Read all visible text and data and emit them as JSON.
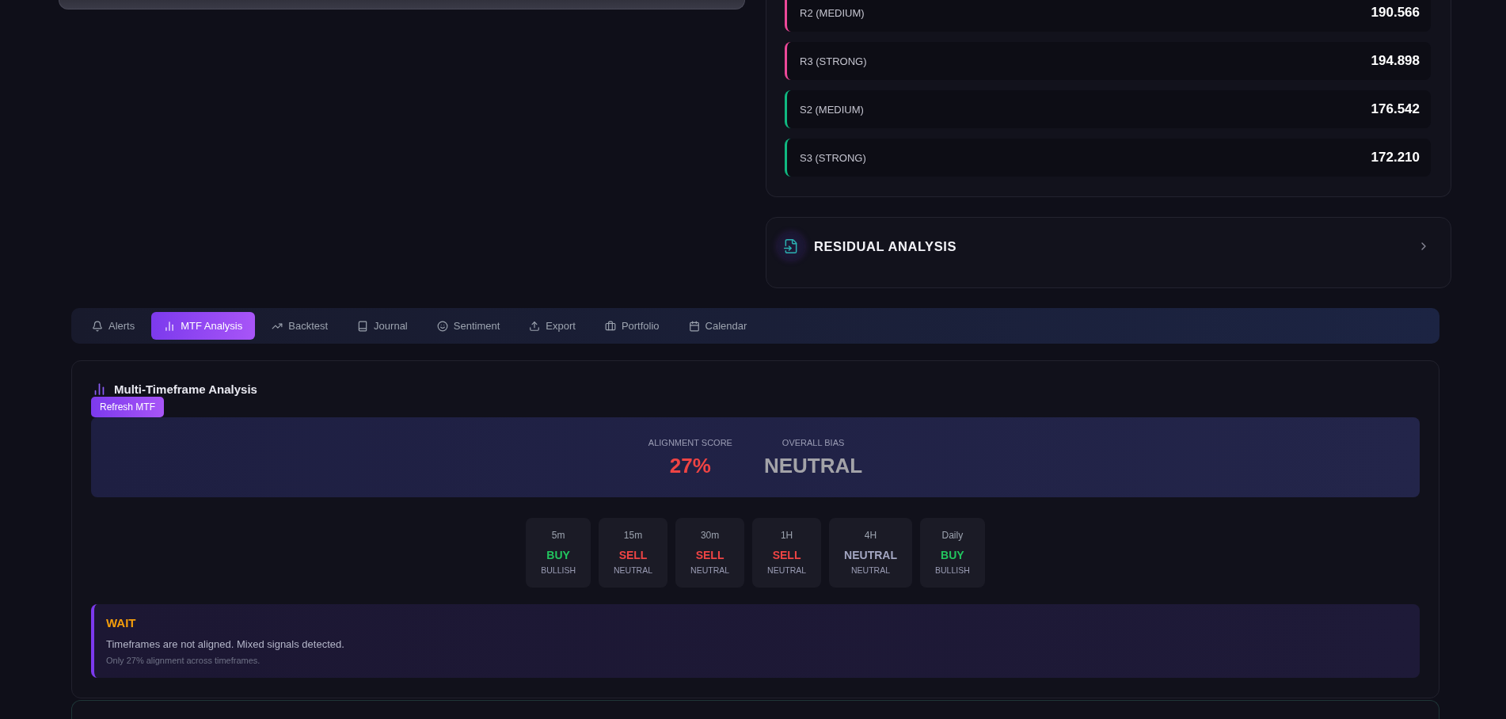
{
  "pivot_levels": [
    {
      "label": "R2 (MEDIUM)",
      "value": "190.566",
      "kind": "resistance"
    },
    {
      "label": "R3 (STRONG)",
      "value": "194.898",
      "kind": "resistance"
    },
    {
      "label": "S2 (MEDIUM)",
      "value": "176.542",
      "kind": "support"
    },
    {
      "label": "S3 (STRONG)",
      "value": "172.210",
      "kind": "support"
    }
  ],
  "residual_analysis": {
    "title": "RESIDUAL ANALYSIS",
    "expanded": false
  },
  "tabs": [
    {
      "label": "Alerts",
      "selected": false
    },
    {
      "label": "MTF Analysis",
      "selected": true
    },
    {
      "label": "Backtest",
      "selected": false
    },
    {
      "label": "Journal",
      "selected": false
    },
    {
      "label": "Sentiment",
      "selected": false
    },
    {
      "label": "Export",
      "selected": false
    },
    {
      "label": "Portfolio",
      "selected": false
    },
    {
      "label": "Calendar",
      "selected": false
    }
  ],
  "mtf_analysis": {
    "title": "Multi-Timeframe Analysis",
    "refresh_button": "Refresh MTF",
    "alignment_score": {
      "label": "ALIGNMENT SCORE",
      "value": "27%"
    },
    "overall_bias": {
      "label": "OVERALL BIAS",
      "value": "NEUTRAL"
    },
    "timeframes": [
      {
        "timeframe": "5m",
        "signal": "BUY",
        "trend": "BULLISH",
        "kind": "buy"
      },
      {
        "timeframe": "15m",
        "signal": "SELL",
        "trend": "NEUTRAL",
        "kind": "sell"
      },
      {
        "timeframe": "30m",
        "signal": "SELL",
        "trend": "NEUTRAL",
        "kind": "sell"
      },
      {
        "timeframe": "1H",
        "signal": "SELL",
        "trend": "NEUTRAL",
        "kind": "sell"
      },
      {
        "timeframe": "4H",
        "signal": "NEUTRAL",
        "trend": "NEUTRAL",
        "kind": "neutral"
      },
      {
        "timeframe": "Daily",
        "signal": "BUY",
        "trend": "BULLISH",
        "kind": "buy"
      }
    ],
    "recommendation": {
      "action": "WAIT",
      "message": "Timeframes are not aligned. Mixed signals detected.",
      "detail": "Only 27% alignment across timeframes."
    }
  }
}
